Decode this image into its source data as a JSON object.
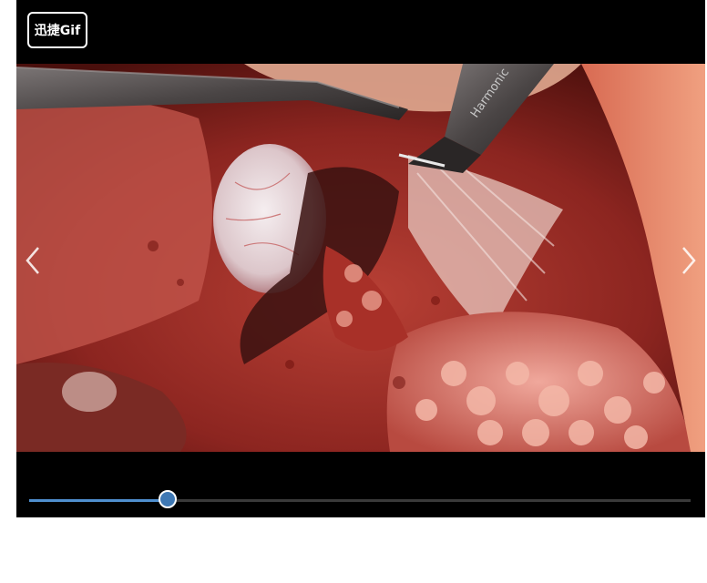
{
  "logo": {
    "text": "迅捷Gif"
  },
  "viewer": {
    "content_icon": "surgical-video-frame",
    "prev_icon": "chevron-left-icon",
    "next_icon": "chevron-right-icon"
  },
  "playback": {
    "progress_fraction": 0.21,
    "played_color": "#4f8fcf",
    "track_color": "#3a3a3a"
  }
}
